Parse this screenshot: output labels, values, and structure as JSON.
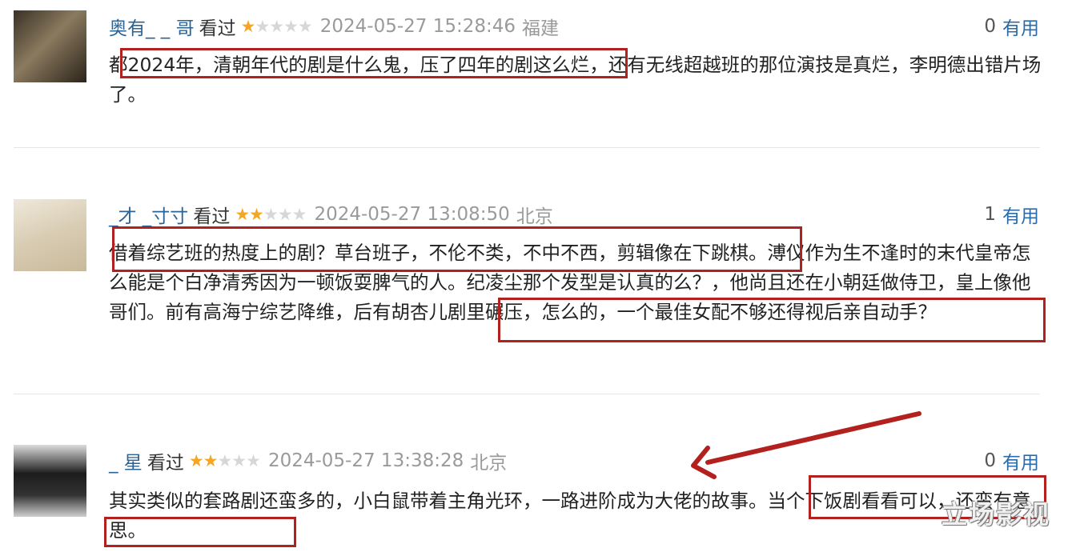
{
  "comments": [
    {
      "username": "奥有_  _ 哥",
      "watched": "看过",
      "rating": 1,
      "time": "2024-05-27 15:28:46",
      "location": "福建",
      "useful_count": "0",
      "useful_label": "有用",
      "text": "都2024年，清朝年代的剧是什么鬼，压了四年的剧这么烂，还有无线超越班的那位演技是真烂，李明德出错片场了。"
    },
    {
      "username": "_才 _寸寸",
      "watched": "看过",
      "rating": 2,
      "time": "2024-05-27 13:08:50",
      "location": "北京",
      "useful_count": "1",
      "useful_label": "有用",
      "text": "借着综艺班的热度上的剧？草台班子，不伦不类，不中不西，剪辑像在下跳棋。溥仪作为生不逢时的末代皇帝怎么能是个白净清秀因为一顿饭耍脾气的人。纪凌尘那个发型是认真的么？，他尚且还在小朝廷做侍卫，皇上像他哥们。前有高海宁综艺降维，后有胡杏儿剧里碾压，怎么的，一个最佳女配不够还得视后亲自动手？"
    },
    {
      "username": "_ 星",
      "watched": "看过",
      "rating": 2,
      "time": "2024-05-27 13:38:28",
      "location": "北京",
      "useful_count": "0",
      "useful_label": "有用",
      "text": "其实类似的套路剧还蛮多的，小白鼠带着主角光环，一路进阶成为大佬的故事。当个下饭剧看看可以，还蛮有意思。"
    }
  ],
  "watermark": "立场影视",
  "colors": {
    "highlight": "#b3211e",
    "star": "#f5a623",
    "link": "#2a6ba8"
  }
}
